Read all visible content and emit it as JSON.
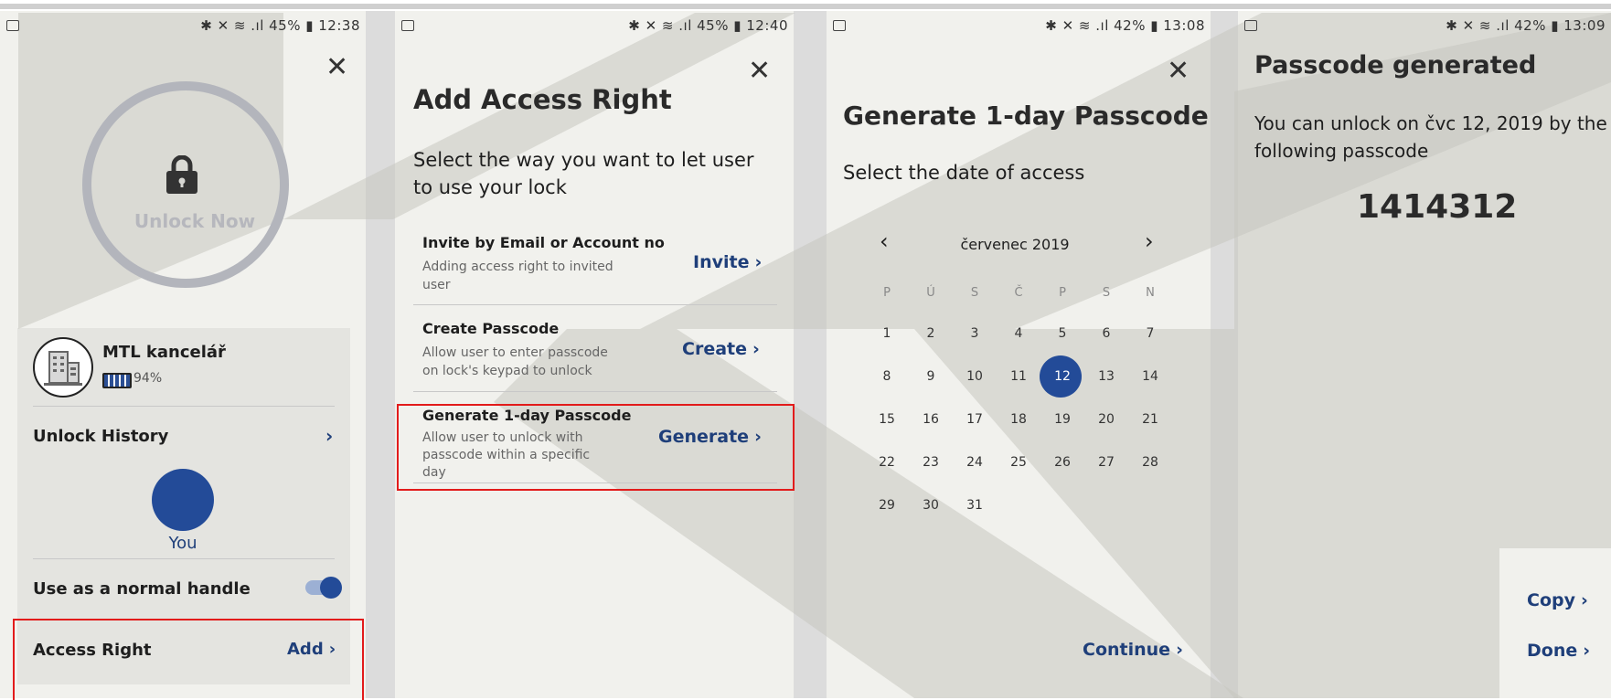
{
  "status_bars": [
    {
      "right": "✱ ✕ ≋ .ıl 45% ▮ 12:38"
    },
    {
      "right": "✱ ✕ ≋ .ıl 45% ▮ 12:40"
    },
    {
      "right": "✱ ✕ ≋ .ıl 42% ▮ 13:08"
    },
    {
      "right": "✱ ✕ ≋ .ıl 42% ▮ 13:09"
    }
  ],
  "close_glyph": "✕",
  "lock_screen": {
    "unlock_now": "Unlock Now",
    "lock_name": "MTL kancelář",
    "battery_level": "94%",
    "unlock_history": "Unlock History",
    "you_label": "You",
    "normal_handle_label": "Use as a normal handle",
    "normal_handle_on": true,
    "access_right_label": "Access Right",
    "access_right_action": "Add"
  },
  "add_access": {
    "title": "Add Access Right",
    "subtitle_line1": "Select the way you want to let user",
    "subtitle_line2": "to use your lock",
    "options": [
      {
        "title": "Invite by Email or Account no",
        "desc1": "Adding access right to invited",
        "desc2": "user",
        "desc3": "",
        "action": "Invite"
      },
      {
        "title": "Create Passcode",
        "desc1": "Allow user to enter passcode",
        "desc2": "on lock's keypad to unlock",
        "desc3": "",
        "action": "Create"
      },
      {
        "title": "Generate 1-day Passcode",
        "desc1": "Allow user to unlock with",
        "desc2": "passcode within a specific",
        "desc3": "day",
        "action": "Generate"
      }
    ]
  },
  "generate_passcode": {
    "title": "Generate 1-day Passcode",
    "subtitle": "Select the date of access",
    "month": "červenec 2019",
    "prev": "‹",
    "next": "›",
    "weekdays": [
      "P",
      "Ú",
      "S",
      "Č",
      "P",
      "S",
      "N"
    ],
    "days": [
      [
        "1",
        "2",
        "3",
        "4",
        "5",
        "6",
        "7"
      ],
      [
        "8",
        "9",
        "10",
        "11",
        "12",
        "13",
        "14"
      ],
      [
        "15",
        "16",
        "17",
        "18",
        "19",
        "20",
        "21"
      ],
      [
        "22",
        "23",
        "24",
        "25",
        "26",
        "27",
        "28"
      ],
      [
        "29",
        "30",
        "31",
        "",
        "",
        "",
        ""
      ]
    ],
    "selected_day": "12",
    "continue": "Continue"
  },
  "passcode_generated": {
    "title": "Passcode generated",
    "line1": "You can unlock on čvc 12, 2019 by the",
    "line2": "following passcode",
    "passcode": "1414312",
    "copy": "Copy",
    "done": "Done"
  },
  "chevron": "›",
  "colors": {
    "accent": "#234b98",
    "link": "#1f3f7a",
    "highlight": "#e21b1b",
    "panel": "#f1f1ed",
    "watermark": "#cfcfca"
  }
}
